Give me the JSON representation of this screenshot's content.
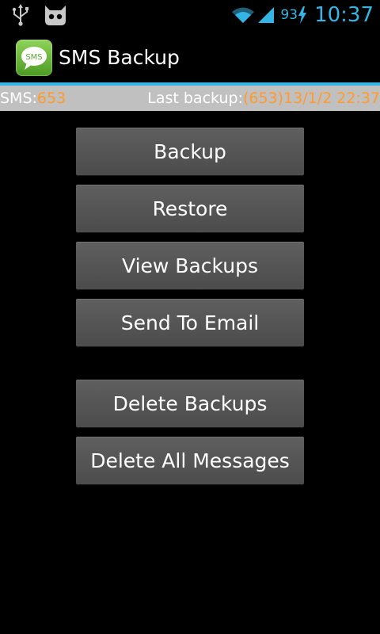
{
  "status_bar": {
    "icons": [
      "usb-icon",
      "cyanogenmod-icon",
      "wifi-icon",
      "signal-icon",
      "charging-bolt-icon"
    ],
    "battery": "93",
    "time": "10:37",
    "accent_color": "#33b5e5"
  },
  "action_bar": {
    "app_icon_text": "SMS",
    "title": "SMS Backup"
  },
  "info_bar": {
    "sms_label": "SMS:",
    "sms_count": "653",
    "last_backup_label": "Last backup:",
    "last_backup_value": "(653)13/1/2 22:37",
    "value_color": "#ff9a2b"
  },
  "buttons": {
    "backup": "Backup",
    "restore": "Restore",
    "view_backups": "View Backups",
    "send_to_email": "Send To Email",
    "delete_backups": "Delete Backups",
    "delete_all_messages": "Delete All Messages"
  }
}
